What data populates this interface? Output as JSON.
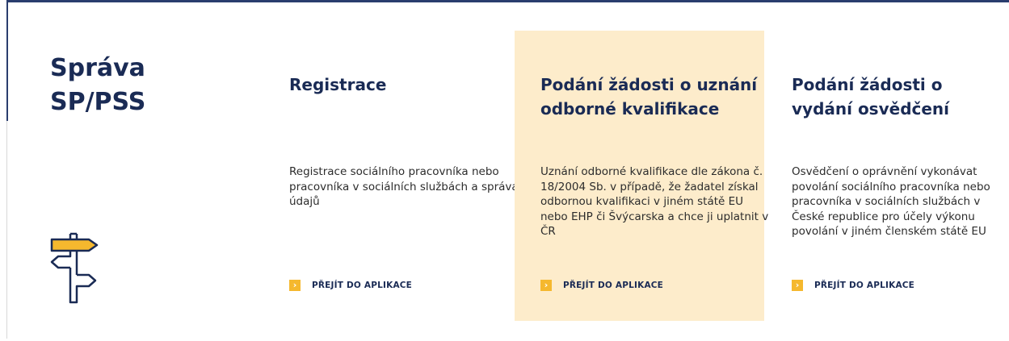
{
  "section": {
    "title": "Správa SP/PSS",
    "icon": "signpost-icon"
  },
  "accent_color": "#f5b82e",
  "highlight_color": "#fdeccb",
  "cards": [
    {
      "title": "Registrace",
      "description": "Registrace sociálního pracovníka nebo pracovníka v sociálních službách a správa údajů",
      "link_label": "PŘEJÍT DO APLIKACE",
      "highlighted": false
    },
    {
      "title": "Podání žádosti o uznání odborné kvalifikace",
      "description": "Uznání odborné kvalifikace dle zákona č. 18/2004 Sb. v případě, že žadatel získal odbornou kvalifikaci v jiném státě EU nebo EHP či Švýcarska a chce ji uplatnit v ČR",
      "link_label": "PŘEJÍT DO APLIKACE",
      "highlighted": true
    },
    {
      "title": "Podání žádosti o vydání osvědčení",
      "description": "Osvědčení o oprávnění vykonávat povolání sociálního pracovníka nebo pracovníka v sociálních službách v České republice pro účely výkonu povolání v jiném členském státě EU",
      "link_label": "PŘEJÍT DO APLIKACE",
      "highlighted": false
    }
  ]
}
